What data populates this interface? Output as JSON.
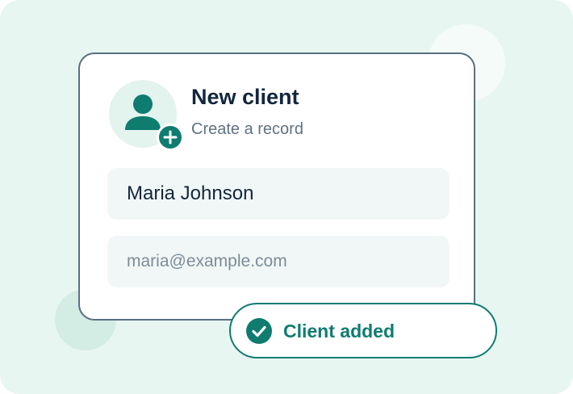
{
  "card": {
    "title": "New client",
    "subtitle": "Create a record",
    "avatar_icon": "person-icon",
    "badge_icon": "plus-icon"
  },
  "form": {
    "name_value": "Maria Johnson",
    "email_value": "maria@example.com"
  },
  "toast": {
    "label": "Client added",
    "icon": "check-circle-icon"
  },
  "colors": {
    "background": "#e8f6f2",
    "accent": "#0f7c70",
    "title_text": "#12263f",
    "muted_text": "#5f7284",
    "card_border": "#5a6f80",
    "field_bg": "#f1f7f6"
  }
}
